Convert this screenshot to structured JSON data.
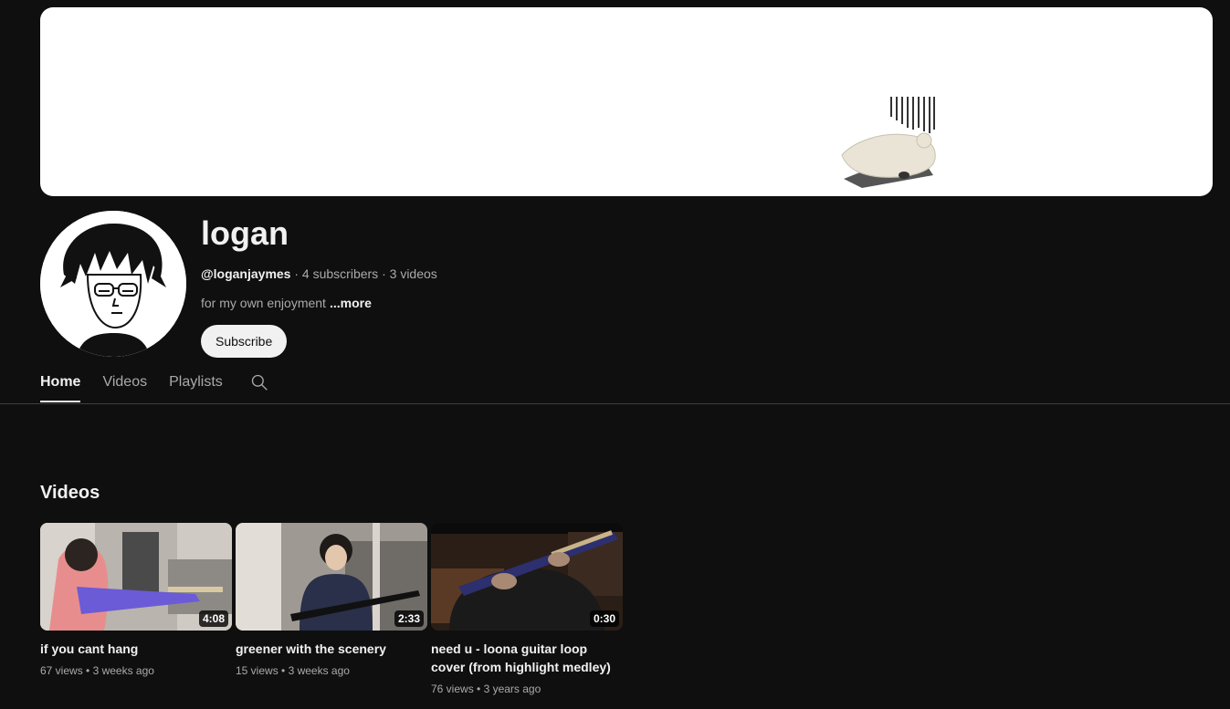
{
  "channel": {
    "name": "logan",
    "handle": "@loganjaymes",
    "separator": " · ",
    "subscribers": "4 subscribers",
    "video_count": "3 videos",
    "description": "for my own enjoyment",
    "more_label": "...more",
    "subscribe_label": "Subscribe"
  },
  "tabs": [
    {
      "label": "Home",
      "active": true
    },
    {
      "label": "Videos",
      "active": false
    },
    {
      "label": "Playlists",
      "active": false
    }
  ],
  "tab_search_icon": "search-icon",
  "section": {
    "title": "Videos"
  },
  "videos": [
    {
      "title": "if you cant hang",
      "views": "67 views",
      "age": "3 weeks ago",
      "duration": "4:08",
      "meta_sep": " • "
    },
    {
      "title": "greener with the scenery",
      "views": "15 views",
      "age": "3 weeks ago",
      "duration": "2:33",
      "meta_sep": " • "
    },
    {
      "title": "need u - loona guitar loop cover (from highlight medley)",
      "views": "76 views",
      "age": "3 years ago",
      "duration": "0:30",
      "meta_sep": " • "
    }
  ],
  "colors": {
    "background": "#0f0f0f",
    "text_primary": "#f1f1f1",
    "text_secondary": "#aaaaaa",
    "subscribe_bg": "#f1f1f1"
  }
}
